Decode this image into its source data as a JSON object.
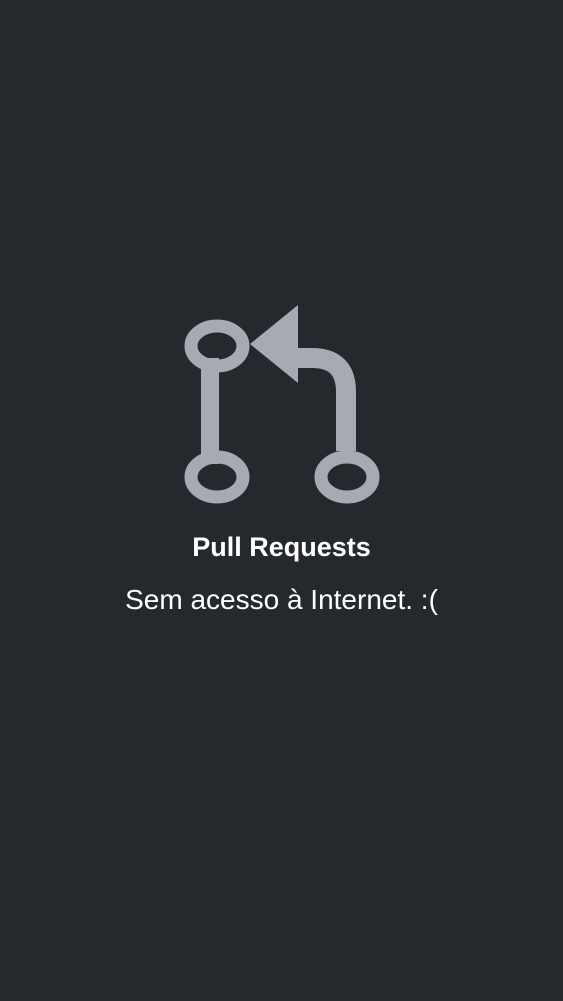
{
  "empty_state": {
    "icon": "git-pull-request-icon",
    "title": "Pull Requests",
    "message": "Sem acesso à Internet. :("
  },
  "colors": {
    "background": "#25292d",
    "icon": "#a6aab3",
    "text": "#ffffff"
  }
}
